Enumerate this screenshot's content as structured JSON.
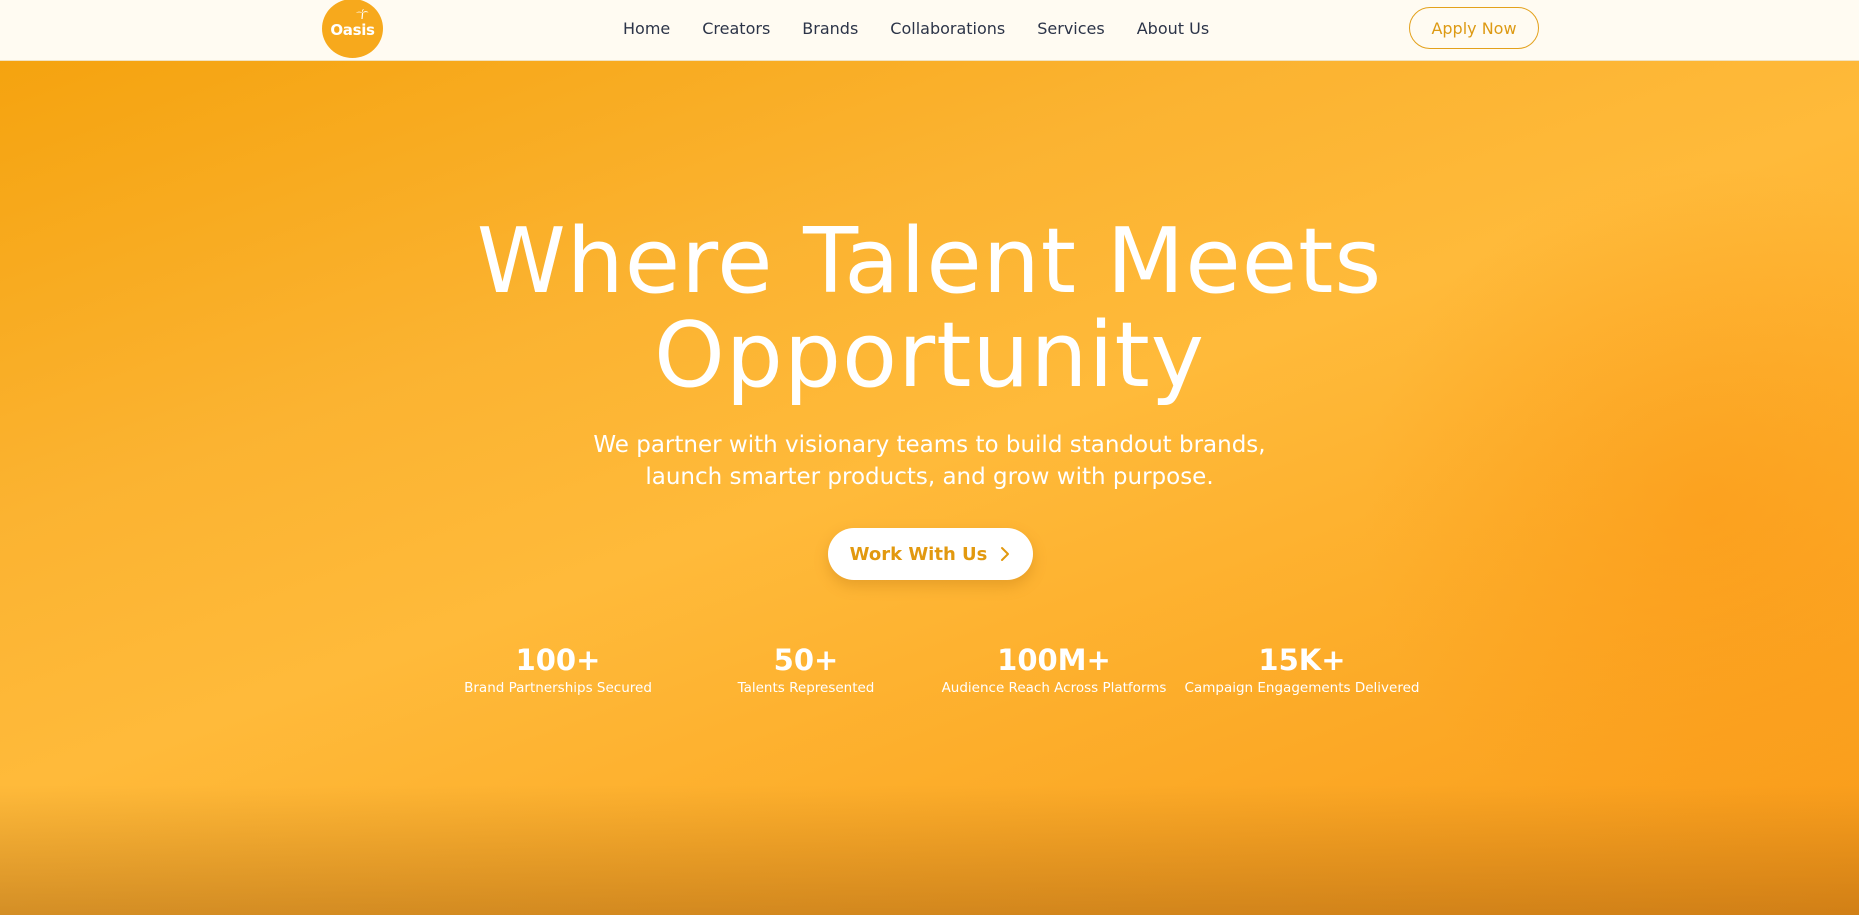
{
  "brand": {
    "logo_text": "Oasis",
    "logo_icon": "palm-tree-icon",
    "color": "#f7a91c"
  },
  "nav": {
    "items": [
      {
        "label": "Home"
      },
      {
        "label": "Creators"
      },
      {
        "label": "Brands"
      },
      {
        "label": "Collaborations"
      },
      {
        "label": "Services"
      },
      {
        "label": "About Us"
      }
    ],
    "apply_label": "Apply Now"
  },
  "hero": {
    "title_line1": "Where Talent Meets",
    "title_line2": "Opportunity",
    "subtitle_line1": "We partner with visionary teams to build standout brands,",
    "subtitle_line2": "launch smarter products, and grow with purpose.",
    "cta_label": "Work With Us",
    "cta_icon": "chevron-right-icon",
    "accent_color": "#e2990f"
  },
  "stats": [
    {
      "value": "100+",
      "label": "Brand Partnerships Secured"
    },
    {
      "value": "50+",
      "label": "Talents Represented"
    },
    {
      "value": "100M+",
      "label": "Audience Reach Across Platforms"
    },
    {
      "value": "15K+",
      "label": "Campaign Engagements Delivered"
    }
  ]
}
